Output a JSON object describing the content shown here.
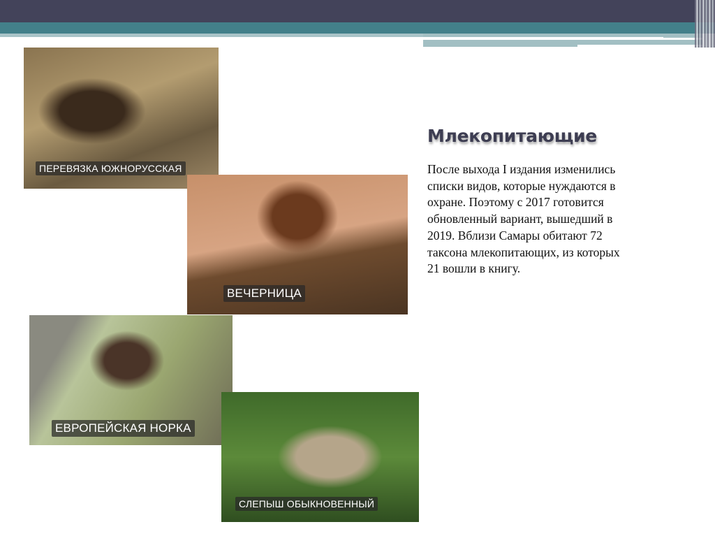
{
  "slide": {
    "title": "Млекопитающие",
    "body_lines": [
      "После выхода I издания изменились",
      "списки видов, которые нуждаются в",
      "охране. Поэтому с 2017 готовится",
      "обновленный вариант, вышедший в",
      "2019. Вблизи Самары обитают 72",
      "таксона млекопитающих, из которых",
      "21 вошли в книгу."
    ],
    "photos": [
      {
        "caption": "ПЕРЕВЯЗКА ЮЖНОРУССКАЯ"
      },
      {
        "caption": "ВЕЧЕРНИЦА"
      },
      {
        "caption": "ЕВРОПЕЙСКАЯ НОРКА"
      },
      {
        "caption": "СЛЕПЫШ ОБЫКНОВЕННЫЙ"
      }
    ]
  },
  "colors": {
    "header_dark": "#43435a",
    "header_teal": "#43808a",
    "title": "#3d3d52"
  }
}
